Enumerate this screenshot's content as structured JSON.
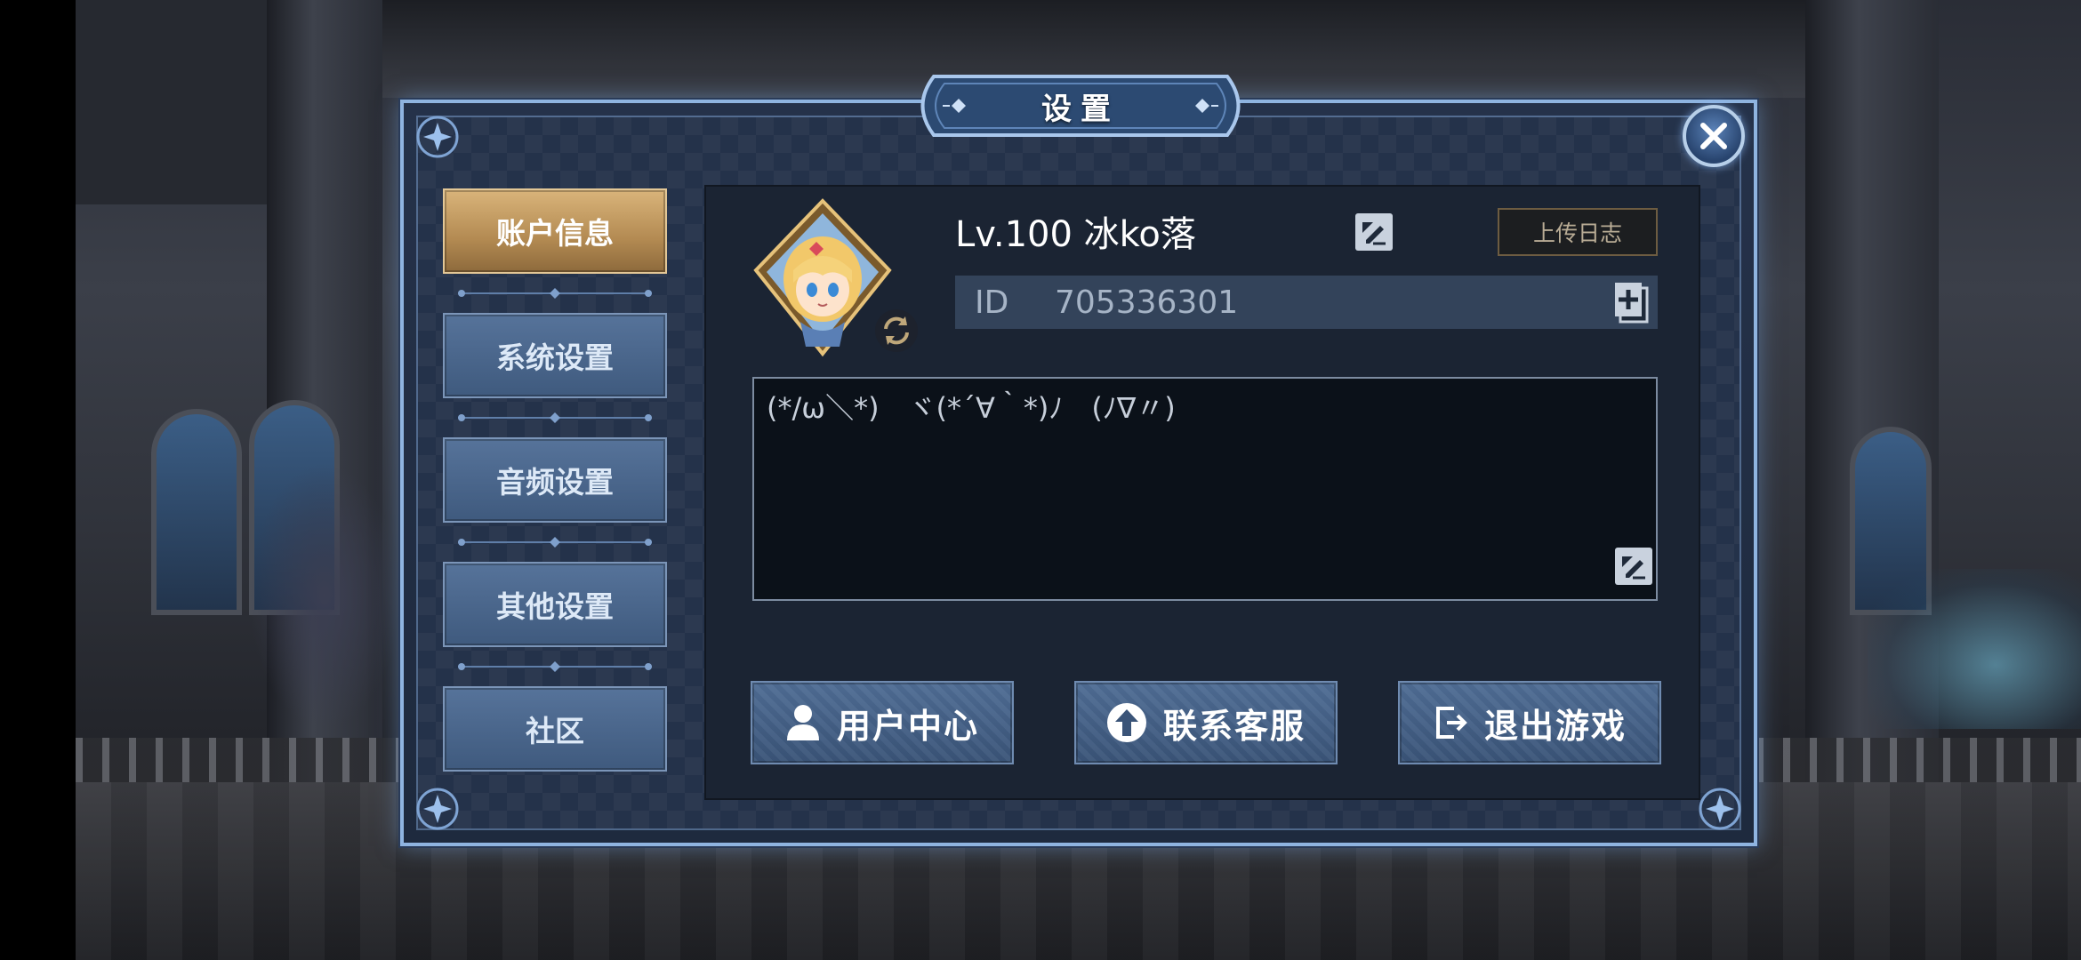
{
  "title": "设置",
  "sidebar": {
    "tabs": [
      {
        "label": "账户信息",
        "active": true
      },
      {
        "label": "系统设置",
        "active": false
      },
      {
        "label": "音频设置",
        "active": false
      },
      {
        "label": "其他设置",
        "active": false
      },
      {
        "label": "社区",
        "active": false
      }
    ]
  },
  "account": {
    "level_name": "Lv.100  冰ko落",
    "upload_log_label": "上传日志",
    "id_label": "ID",
    "id_value": "705336301",
    "signature": "(*/ω＼*)　ヾ(*´∀｀*)ﾉ　(ﾉ∇〃)"
  },
  "actions": {
    "user_center": "用户中心",
    "contact_service": "联系客服",
    "exit_game": "退出游戏"
  },
  "icons": {
    "close": "close-icon",
    "edit": "edit-icon",
    "copy": "copy-icon",
    "refresh": "refresh-icon",
    "user": "user-icon",
    "upload": "arrow-up-icon",
    "exit": "exit-icon"
  },
  "colors": {
    "active_tab": "#c9a163",
    "tab": "#4b6890",
    "frame": "#8fb4e0",
    "panel": "#1b2433"
  }
}
